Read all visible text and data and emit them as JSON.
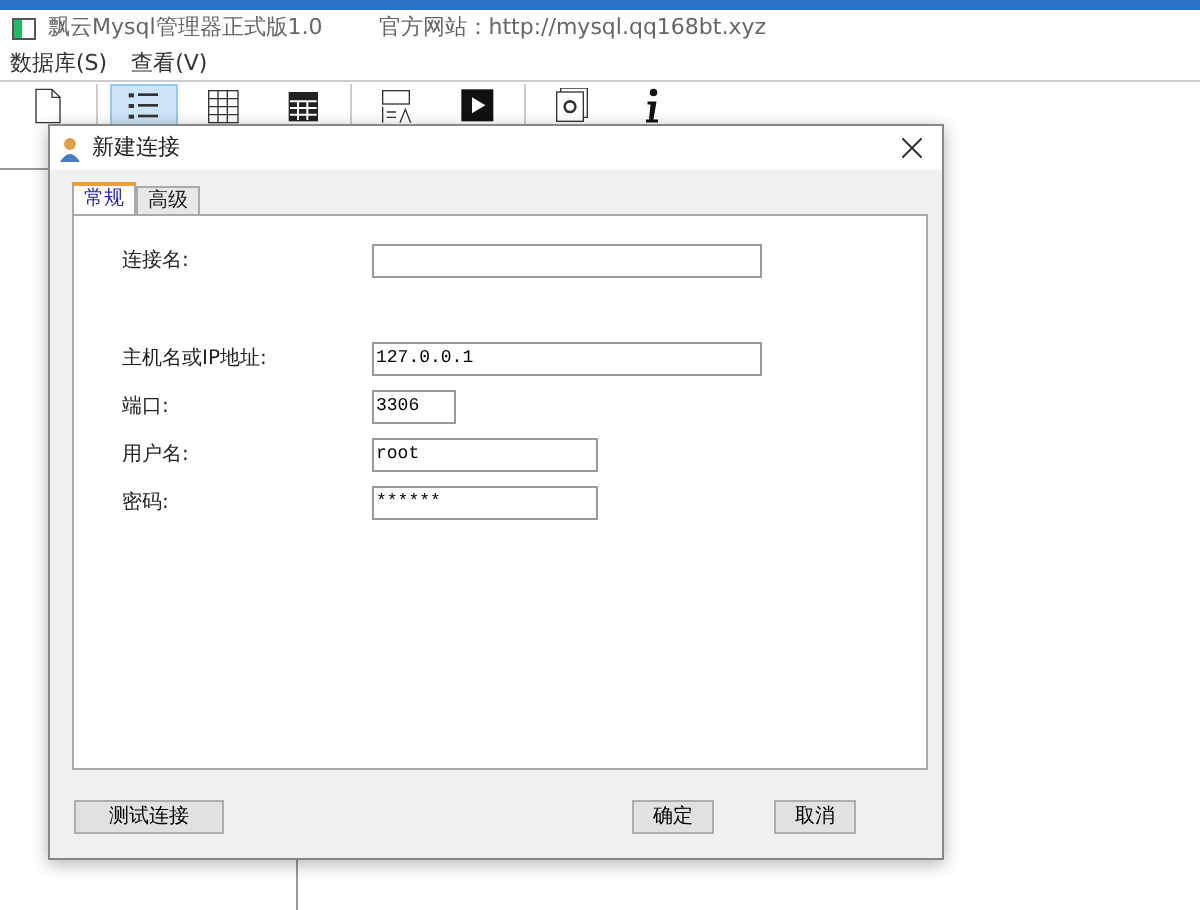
{
  "window": {
    "title": "飘云Mysql管理器正式版1.0",
    "website": "官方网站：http://mysql.qq168bt.xyz"
  },
  "menu": [
    "数据库(S)",
    "查看(V)"
  ],
  "toolbar": [
    {
      "kind": "new-file",
      "selected": false
    },
    {
      "kind": "list",
      "selected": true
    },
    {
      "kind": "grid",
      "selected": false
    },
    {
      "kind": "table",
      "selected": false
    },
    {
      "kind": "form",
      "selected": false
    },
    {
      "kind": "play",
      "selected": false
    },
    {
      "kind": "settings",
      "selected": false
    },
    {
      "kind": "info",
      "selected": false
    }
  ],
  "dialog": {
    "title": "新建连接",
    "tabs": [
      {
        "label": "常规",
        "selected": true
      },
      {
        "label": "高级",
        "selected": false
      }
    ],
    "fields": [
      {
        "label": "连接名:"
      },
      {
        "label": "主机名或IP地址:",
        "value": "127.0.0.1"
      },
      {
        "label": "端口:",
        "value": "3306"
      },
      {
        "label": "用户名:",
        "value": "root"
      },
      {
        "label": "密码:",
        "value": "******"
      }
    ],
    "buttons": [
      "测试连接",
      "确定",
      "取消"
    ]
  }
}
